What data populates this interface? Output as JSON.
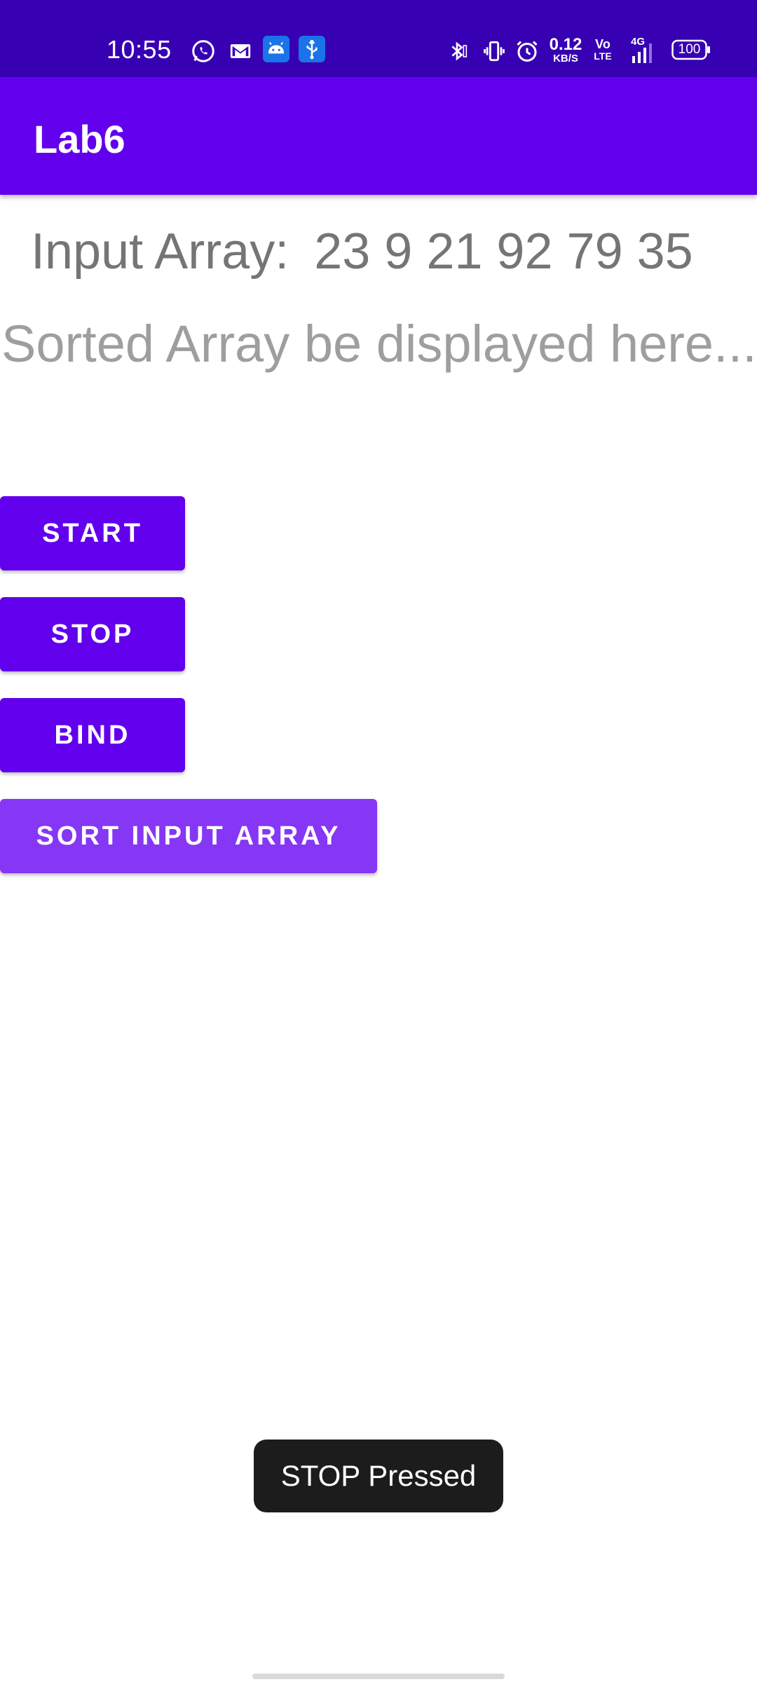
{
  "status_bar": {
    "time": "10:55",
    "notification_icons": [
      "whatsapp-icon",
      "gmail-icon",
      "android-icon",
      "usb-icon"
    ],
    "system_icons": [
      "bluetooth-icon",
      "vibrate-icon",
      "alarm-icon"
    ],
    "network_speed_value": "0.12",
    "network_speed_unit": "KB/S",
    "volte_top": "Vo",
    "volte_bottom": "LTE",
    "network_type": "4G",
    "battery": "100"
  },
  "app_bar": {
    "title": "Lab6"
  },
  "main": {
    "input_label": "Input Array:",
    "input_values": "23 9 21 92 79 35",
    "sorted_placeholder": "Sorted Array be displayed here...",
    "buttons": {
      "start": "START",
      "stop": "STOP",
      "bind": "BIND",
      "sort": "SORT INPUT ARRAY"
    }
  },
  "toast": {
    "message": "STOP Pressed"
  },
  "colors": {
    "status_bar": "#3700b3",
    "app_bar": "#6200ee",
    "button": "#6200ee",
    "button_pressed": "#8637f5",
    "toast_bg": "#1c1c1c"
  }
}
